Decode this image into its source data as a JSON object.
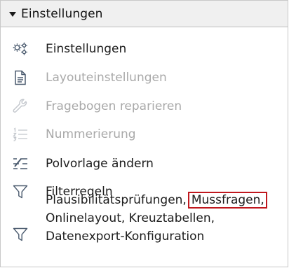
{
  "section": {
    "title": "Einstellungen",
    "expanded": true
  },
  "items": [
    {
      "label": "Einstellungen",
      "icon": "gears-icon",
      "enabled": true
    },
    {
      "label": "Layouteinstellungen",
      "icon": "document-icon",
      "enabled": false
    },
    {
      "label": "Fragebogen reparieren",
      "icon": "wrench-icon",
      "enabled": false
    },
    {
      "label": "Nummerierung",
      "icon": "numbered-list-icon",
      "enabled": false
    },
    {
      "label": "Polvorlage ändern",
      "icon": "pole-template-icon",
      "enabled": true
    },
    {
      "label": "Filterregeln",
      "icon": "filter-icon",
      "enabled": true
    }
  ],
  "multi_item": {
    "icon": "filter-icon",
    "enabled": true,
    "line1_before": "Plausibilitätsprüfungen,",
    "line1_highlight": "Mussfragen,",
    "line2": "Onlinelayout, Kreuztabellen,",
    "line3": "Datenexport-Konfiguration"
  },
  "colors": {
    "header_bg": "#f0f0f0",
    "icon_enabled": "#4a5a6e",
    "icon_disabled": "#c2c6cc",
    "text_enabled": "#1c1c1c",
    "text_disabled": "#a9a9a9",
    "highlight_border": "#c0181e"
  }
}
